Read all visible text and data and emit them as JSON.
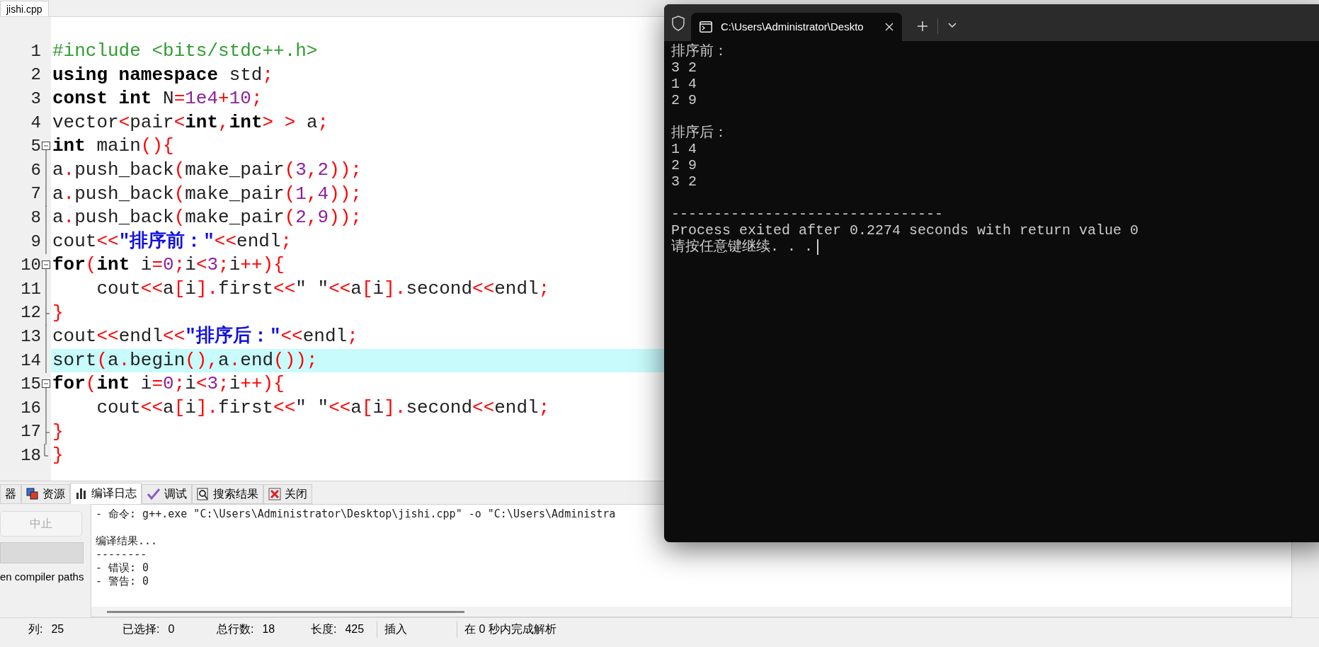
{
  "editor": {
    "tab": {
      "label": "jishi.cpp",
      "selected": true
    },
    "lines": [
      {
        "number": "1",
        "kind": "none",
        "highlighted": false,
        "tokens": [
          {
            "kind": "preproc",
            "text": "#include <bits/stdc++.h>"
          }
        ]
      },
      {
        "number": "2",
        "kind": "none",
        "highlighted": false,
        "tokens": [
          {
            "kind": "keyword",
            "text": "using"
          },
          {
            "kind": "keyword",
            "text": " namespace"
          },
          {
            "kind": "plain",
            "text": " std"
          },
          {
            "kind": "punct",
            "text": ";"
          }
        ]
      },
      {
        "number": "3",
        "kind": "none",
        "highlighted": false,
        "tokens": [
          {
            "kind": "keyword",
            "text": "const"
          },
          {
            "kind": "keyword",
            "text": " int"
          },
          {
            "kind": "plain",
            "text": " N"
          },
          {
            "kind": "punct",
            "text": "="
          },
          {
            "kind": "number",
            "text": "1e4"
          },
          {
            "kind": "punct",
            "text": "+"
          },
          {
            "kind": "number",
            "text": "10"
          },
          {
            "kind": "punct",
            "text": ";"
          }
        ]
      },
      {
        "number": "4",
        "kind": "none",
        "highlighted": false,
        "tokens": [
          {
            "kind": "plain",
            "text": "vector"
          },
          {
            "kind": "punct",
            "text": "<"
          },
          {
            "kind": "plain",
            "text": "pair"
          },
          {
            "kind": "punct",
            "text": "<"
          },
          {
            "kind": "keyword",
            "text": "int"
          },
          {
            "kind": "punct",
            "text": ","
          },
          {
            "kind": "keyword",
            "text": "int"
          },
          {
            "kind": "punct",
            "text": "> >"
          },
          {
            "kind": "plain",
            "text": " a"
          },
          {
            "kind": "punct",
            "text": ";"
          }
        ]
      },
      {
        "number": "5",
        "kind": "start",
        "highlighted": false,
        "tokens": [
          {
            "kind": "keyword",
            "text": "int"
          },
          {
            "kind": "plain",
            "text": " main"
          },
          {
            "kind": "punct",
            "text": "(){"
          }
        ]
      },
      {
        "number": "6",
        "kind": "body",
        "highlighted": false,
        "tokens": [
          {
            "kind": "plain",
            "text": "a"
          },
          {
            "kind": "punct",
            "text": "."
          },
          {
            "kind": "plain",
            "text": "push_back"
          },
          {
            "kind": "punct",
            "text": "("
          },
          {
            "kind": "plain",
            "text": "make_pair"
          },
          {
            "kind": "punct",
            "text": "("
          },
          {
            "kind": "number",
            "text": "3"
          },
          {
            "kind": "punct",
            "text": ","
          },
          {
            "kind": "number",
            "text": "2"
          },
          {
            "kind": "punct",
            "text": "));"
          }
        ]
      },
      {
        "number": "7",
        "kind": "body",
        "highlighted": false,
        "tokens": [
          {
            "kind": "plain",
            "text": "a"
          },
          {
            "kind": "punct",
            "text": "."
          },
          {
            "kind": "plain",
            "text": "push_back"
          },
          {
            "kind": "punct",
            "text": "("
          },
          {
            "kind": "plain",
            "text": "make_pair"
          },
          {
            "kind": "punct",
            "text": "("
          },
          {
            "kind": "number",
            "text": "1"
          },
          {
            "kind": "punct",
            "text": ","
          },
          {
            "kind": "number",
            "text": "4"
          },
          {
            "kind": "punct",
            "text": "));"
          }
        ]
      },
      {
        "number": "8",
        "kind": "body",
        "highlighted": false,
        "tokens": [
          {
            "kind": "plain",
            "text": "a"
          },
          {
            "kind": "punct",
            "text": "."
          },
          {
            "kind": "plain",
            "text": "push_back"
          },
          {
            "kind": "punct",
            "text": "("
          },
          {
            "kind": "plain",
            "text": "make_pair"
          },
          {
            "kind": "punct",
            "text": "("
          },
          {
            "kind": "number",
            "text": "2"
          },
          {
            "kind": "punct",
            "text": ","
          },
          {
            "kind": "number",
            "text": "9"
          },
          {
            "kind": "punct",
            "text": "));"
          }
        ]
      },
      {
        "number": "9",
        "kind": "body",
        "highlighted": false,
        "tokens": [
          {
            "kind": "plain",
            "text": "cout"
          },
          {
            "kind": "punct",
            "text": "<<"
          },
          {
            "kind": "string",
            "text": "\"排序前：\""
          },
          {
            "kind": "punct",
            "text": "<<"
          },
          {
            "kind": "plain",
            "text": "endl"
          },
          {
            "kind": "punct",
            "text": ";"
          }
        ]
      },
      {
        "number": "10",
        "kind": "start",
        "highlighted": false,
        "tokens": [
          {
            "kind": "keyword",
            "text": "for"
          },
          {
            "kind": "punct",
            "text": "("
          },
          {
            "kind": "keyword",
            "text": "int"
          },
          {
            "kind": "plain",
            "text": " i"
          },
          {
            "kind": "punct",
            "text": "="
          },
          {
            "kind": "number",
            "text": "0"
          },
          {
            "kind": "punct",
            "text": ";"
          },
          {
            "kind": "plain",
            "text": "i"
          },
          {
            "kind": "punct",
            "text": "<"
          },
          {
            "kind": "number",
            "text": "3"
          },
          {
            "kind": "punct",
            "text": ";"
          },
          {
            "kind": "plain",
            "text": "i"
          },
          {
            "kind": "punct",
            "text": "++){"
          }
        ]
      },
      {
        "number": "11",
        "kind": "body",
        "highlighted": false,
        "tokens": [
          {
            "kind": "plain",
            "text": "    cout"
          },
          {
            "kind": "punct",
            "text": "<<"
          },
          {
            "kind": "plain",
            "text": "a"
          },
          {
            "kind": "punct",
            "text": "["
          },
          {
            "kind": "plain",
            "text": "i"
          },
          {
            "kind": "punct",
            "text": "]."
          },
          {
            "kind": "plain",
            "text": "first"
          },
          {
            "kind": "punct",
            "text": "<<"
          },
          {
            "kind": "plain",
            "text": "\" \""
          },
          {
            "kind": "punct",
            "text": "<<"
          },
          {
            "kind": "plain",
            "text": "a"
          },
          {
            "kind": "punct",
            "text": "["
          },
          {
            "kind": "plain",
            "text": "i"
          },
          {
            "kind": "punct",
            "text": "]."
          },
          {
            "kind": "plain",
            "text": "second"
          },
          {
            "kind": "punct",
            "text": "<<"
          },
          {
            "kind": "plain",
            "text": "endl"
          },
          {
            "kind": "punct",
            "text": ";"
          }
        ]
      },
      {
        "number": "12",
        "kind": "end",
        "highlighted": false,
        "tokens": [
          {
            "kind": "punct",
            "text": "}"
          }
        ]
      },
      {
        "number": "13",
        "kind": "body",
        "highlighted": false,
        "tokens": [
          {
            "kind": "plain",
            "text": "cout"
          },
          {
            "kind": "punct",
            "text": "<<"
          },
          {
            "kind": "plain",
            "text": "endl"
          },
          {
            "kind": "punct",
            "text": "<<"
          },
          {
            "kind": "string",
            "text": "\"排序后：\""
          },
          {
            "kind": "punct",
            "text": "<<"
          },
          {
            "kind": "plain",
            "text": "endl"
          },
          {
            "kind": "punct",
            "text": ";"
          }
        ]
      },
      {
        "number": "14",
        "kind": "body",
        "highlighted": true,
        "tokens": [
          {
            "kind": "plain",
            "text": "sort"
          },
          {
            "kind": "punct",
            "text": "("
          },
          {
            "kind": "plain",
            "text": "a"
          },
          {
            "kind": "punct",
            "text": "."
          },
          {
            "kind": "plain",
            "text": "begin"
          },
          {
            "kind": "punct",
            "text": "(),"
          },
          {
            "kind": "plain",
            "text": "a"
          },
          {
            "kind": "punct",
            "text": "."
          },
          {
            "kind": "plain",
            "text": "end"
          },
          {
            "kind": "punct",
            "text": "());"
          }
        ]
      },
      {
        "number": "15",
        "kind": "start",
        "highlighted": false,
        "tokens": [
          {
            "kind": "keyword",
            "text": "for"
          },
          {
            "kind": "punct",
            "text": "("
          },
          {
            "kind": "keyword",
            "text": "int"
          },
          {
            "kind": "plain",
            "text": " i"
          },
          {
            "kind": "punct",
            "text": "="
          },
          {
            "kind": "number",
            "text": "0"
          },
          {
            "kind": "punct",
            "text": ";"
          },
          {
            "kind": "plain",
            "text": "i"
          },
          {
            "kind": "punct",
            "text": "<"
          },
          {
            "kind": "number",
            "text": "3"
          },
          {
            "kind": "punct",
            "text": ";"
          },
          {
            "kind": "plain",
            "text": "i"
          },
          {
            "kind": "punct",
            "text": "++){"
          }
        ]
      },
      {
        "number": "16",
        "kind": "body",
        "highlighted": false,
        "tokens": [
          {
            "kind": "plain",
            "text": "    cout"
          },
          {
            "kind": "punct",
            "text": "<<"
          },
          {
            "kind": "plain",
            "text": "a"
          },
          {
            "kind": "punct",
            "text": "["
          },
          {
            "kind": "plain",
            "text": "i"
          },
          {
            "kind": "punct",
            "text": "]."
          },
          {
            "kind": "plain",
            "text": "first"
          },
          {
            "kind": "punct",
            "text": "<<"
          },
          {
            "kind": "plain",
            "text": "\" \""
          },
          {
            "kind": "punct",
            "text": "<<"
          },
          {
            "kind": "plain",
            "text": "a"
          },
          {
            "kind": "punct",
            "text": "["
          },
          {
            "kind": "plain",
            "text": "i"
          },
          {
            "kind": "punct",
            "text": "]."
          },
          {
            "kind": "plain",
            "text": "second"
          },
          {
            "kind": "punct",
            "text": "<<"
          },
          {
            "kind": "plain",
            "text": "endl"
          },
          {
            "kind": "punct",
            "text": ";"
          }
        ]
      },
      {
        "number": "17",
        "kind": "end",
        "highlighted": false,
        "tokens": [
          {
            "kind": "punct",
            "text": "}"
          }
        ]
      },
      {
        "number": "18",
        "kind": "last",
        "highlighted": false,
        "tokens": [
          {
            "kind": "punct",
            "text": "}"
          }
        ]
      }
    ]
  },
  "bottom_panel": {
    "tabs": [
      {
        "label": "器",
        "selected": false
      },
      {
        "label": "资源",
        "selected": false
      },
      {
        "label": "编译日志",
        "selected": true
      },
      {
        "label": "调试",
        "selected": false
      },
      {
        "label": "搜索结果",
        "selected": false
      },
      {
        "label": "关闭",
        "selected": false
      }
    ],
    "stop_button": {
      "label": "中止",
      "disabled": true
    },
    "compiler_paths_text": "en compiler paths",
    "log_blocks": [
      [
        "- 命令: g++.exe \"C:\\Users\\Administrator\\Desktop\\jishi.cpp\" -o \"C:\\Users\\Administra"
      ],
      [
        "编译结果...",
        "--------",
        "- 错误: 0",
        "- 警告: 0"
      ]
    ]
  },
  "status_bar": [
    {
      "kind": "field",
      "label": "列:",
      "value": "25"
    },
    {
      "kind": "field",
      "label": "已选择:",
      "value": "0"
    },
    {
      "kind": "field",
      "label": "总行数:",
      "value": "18"
    },
    {
      "kind": "field",
      "label": "长度:",
      "value": "425"
    },
    {
      "kind": "text",
      "label": "插入"
    },
    {
      "kind": "text",
      "label": "在 0 秒内完成解析"
    }
  ],
  "terminal": {
    "tab": {
      "title": "C:\\Users\\Administrator\\Deskto",
      "selected": true
    },
    "blocks": [
      [
        "排序前：",
        "3 2",
        "1 4",
        "2 9"
      ],
      [
        "排序后：",
        "1 4",
        "2 9",
        "3 2"
      ],
      [
        "--------------------------------",
        "Process exited after 0.2274 seconds with return value 0",
        "请按任意键继续. . ."
      ]
    ]
  }
}
